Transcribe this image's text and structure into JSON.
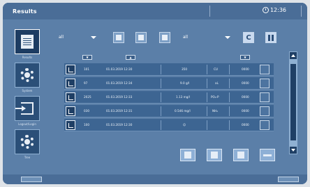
{
  "window": {
    "title": "Results",
    "time": "12:36"
  },
  "nav": [
    {
      "id": "results",
      "label": "Results",
      "icon": "document-icon",
      "active": true
    },
    {
      "id": "system",
      "label": "System",
      "icon": "gear-icon",
      "active": false
    },
    {
      "id": "login",
      "label": "Logout/Login",
      "icon": "login-icon",
      "active": false
    },
    {
      "id": "tree",
      "label": "Tree",
      "icon": "gear-icon",
      "active": false
    }
  ],
  "toolbar": {
    "filter1": "all",
    "filter2": "all",
    "clear_label": "C"
  },
  "columns": [
    "▼",
    "▲",
    "▼"
  ],
  "rows": [
    {
      "id": "101",
      "date": "01.03.2019 12:30",
      "value": "350",
      "unit": "CU",
      "status": "0000"
    },
    {
      "id": "97",
      "date": "01.03.2019 12:34",
      "value": "9.0 g/l",
      "unit": "aL",
      "status": "0000"
    },
    {
      "id": "2025",
      "date": "01.03.2019 12:33",
      "value": "1.13 mg/l",
      "unit": "PO₄-P",
      "status": "0000"
    },
    {
      "id": "030",
      "date": "01.03.2019 12:31",
      "value": "0.546 mg/l",
      "unit": "NH₄",
      "status": "0000"
    },
    {
      "id": "100",
      "date": "01.03.2019 12:30",
      "value": "☺",
      "unit": "",
      "status": "0000"
    }
  ],
  "colors": {
    "screen": "#5b7fa8",
    "titlebar": "#4a6d97",
    "row": "#3d6592",
    "accent_dark": "#1f3f65"
  }
}
